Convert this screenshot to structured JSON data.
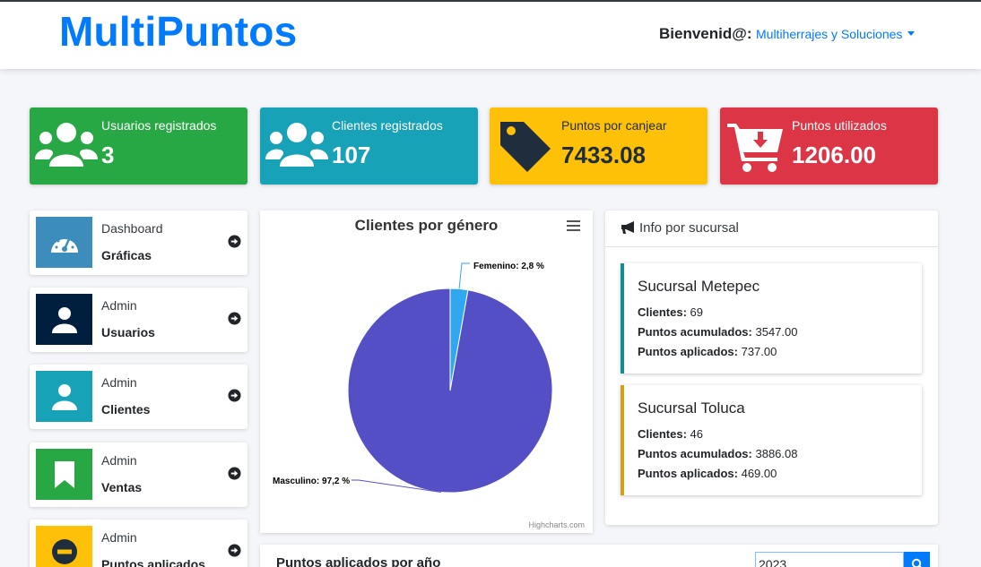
{
  "navbar": {
    "brand": "MultiPuntos",
    "welcome": "Bienvenid@:",
    "user": "Multiherrajes y Soluciones"
  },
  "stats": [
    {
      "label": "Usuarios registrados",
      "value": "3",
      "icon": "users-icon",
      "color": "#28a745"
    },
    {
      "label": "Clientes registrados",
      "value": "107",
      "icon": "users-icon",
      "color": "#17a2b8"
    },
    {
      "label": "Puntos por canjear",
      "value": "7433.08",
      "icon": "tag-icon",
      "color": "#ffc107"
    },
    {
      "label": "Puntos utilizados",
      "value": "1206.00",
      "icon": "cart-download-icon",
      "color": "#dc3545"
    }
  ],
  "menu": [
    {
      "top": "Dashboard",
      "bottom": "Gráficas",
      "icon": "gauge-icon",
      "color": "#3c8dbc"
    },
    {
      "top": "Admin",
      "bottom": "Usuarios",
      "icon": "user-icon",
      "color": "#001f3f"
    },
    {
      "top": "Admin",
      "bottom": "Clientes",
      "icon": "user-icon",
      "color": "#17a2b8"
    },
    {
      "top": "Admin",
      "bottom": "Ventas",
      "icon": "bookmark-icon",
      "color": "#28a745"
    },
    {
      "top": "Admin",
      "bottom": "Puntos aplicados",
      "icon": "minus-circle-icon",
      "color": "#ffc107"
    }
  ],
  "chart": {
    "credits": "Highcharts.com"
  },
  "chart_data": {
    "type": "pie",
    "title": "Clientes por género",
    "slices": [
      {
        "name": "Femenino",
        "value": 2.8,
        "label": "Femenino: 2,8 %",
        "color": "#2fa8ef"
      },
      {
        "name": "Masculino",
        "value": 97.2,
        "label": "Masculino: 97,2 %",
        "color": "#544fc5"
      }
    ]
  },
  "info": {
    "title": "Info por sucursal",
    "branches": [
      {
        "name": "Sucursal Metepec",
        "accent": "#138d90",
        "clientes_label": "Clientes:",
        "clientes": "69",
        "acum_label": "Puntos acumulados:",
        "acum": "3547.00",
        "apl_label": "Puntos aplicados:",
        "apl": "737.00"
      },
      {
        "name": "Sucursal Toluca",
        "accent": "#d4a017",
        "clientes_label": "Clientes:",
        "clientes": "46",
        "acum_label": "Puntos acumulados:",
        "acum": "3886.08",
        "apl_label": "Puntos aplicados:",
        "apl": "469.00"
      }
    ]
  },
  "bottom": {
    "title": "Puntos aplicados por año",
    "year": "2023"
  }
}
